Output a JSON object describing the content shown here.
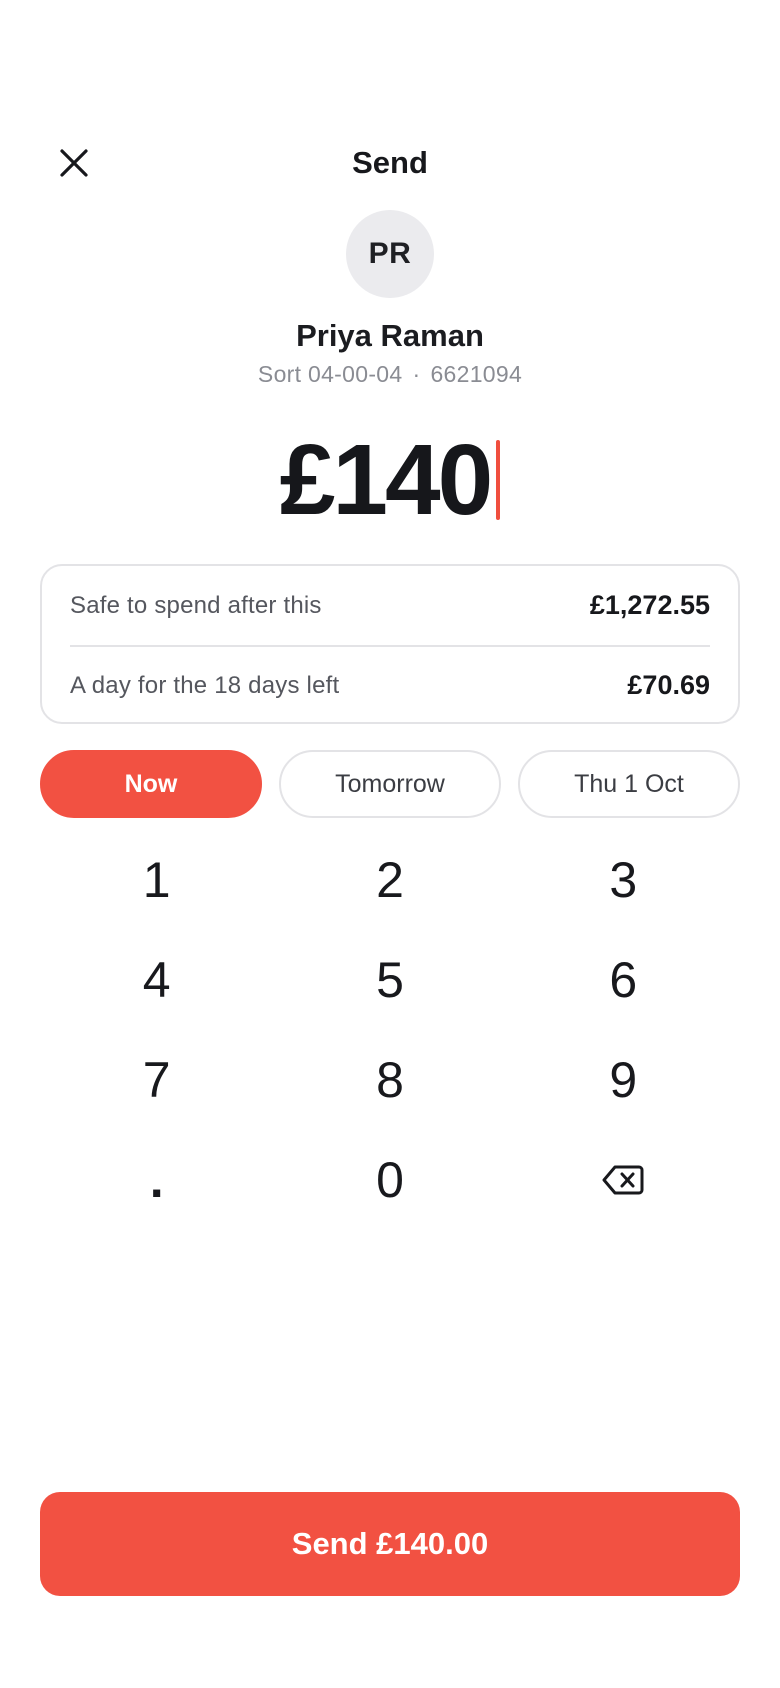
{
  "header": {
    "title": "Send",
    "close_icon": "close-icon"
  },
  "recipient": {
    "initials": "PR",
    "name": "Priya Raman",
    "sort_code": "Sort 04-00-04",
    "separator": "·",
    "account_number": "6621094"
  },
  "amount": {
    "display": "£140"
  },
  "summary": {
    "rows": [
      {
        "label": "Safe to spend after this",
        "value": "£1,272.55"
      },
      {
        "label": "A day for the 18 days left",
        "value": "£70.69"
      }
    ]
  },
  "timing": {
    "options": [
      {
        "label": "Now",
        "selected": true
      },
      {
        "label": "Tomorrow",
        "selected": false
      },
      {
        "label": "Thu 1 Oct",
        "selected": false
      }
    ]
  },
  "keypad": {
    "keys": [
      "1",
      "2",
      "3",
      "4",
      "5",
      "6",
      "7",
      "8",
      "9",
      ".",
      "0"
    ],
    "backspace_icon": "backspace-icon"
  },
  "send_button": {
    "label": "Send £140.00"
  },
  "colors": {
    "accent": "#f25142",
    "text_primary": "#17181c",
    "text_secondary": "#8a8c93",
    "border": "#e3e3e6",
    "avatar_bg": "#ebebee"
  }
}
